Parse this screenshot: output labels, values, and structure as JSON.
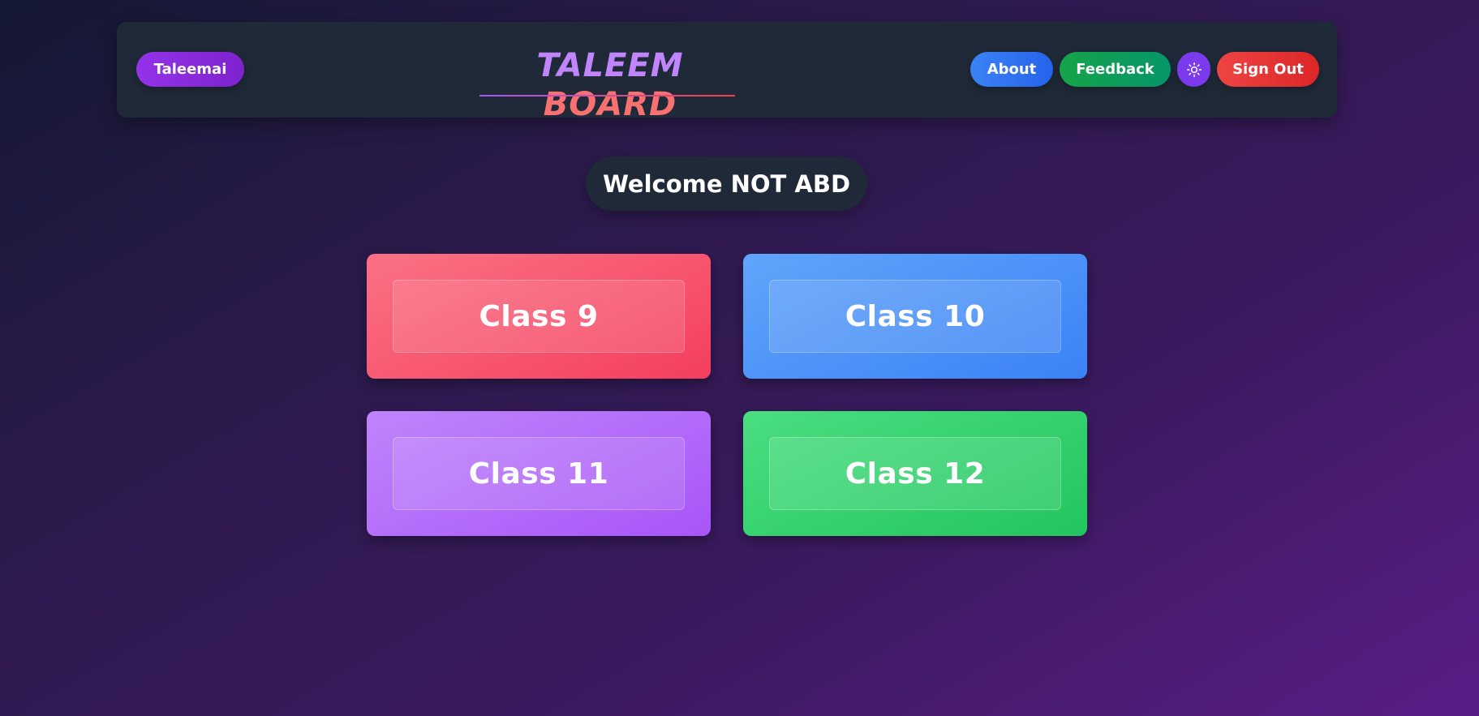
{
  "header": {
    "brand_button": "Taleemai",
    "logo_word1": "TALEEM",
    "logo_word2": "BOARD",
    "about_label": "About",
    "feedback_label": "Feedback",
    "theme_toggle_icon": "sun-icon",
    "signout_label": "Sign Out"
  },
  "welcome": {
    "text": "Welcome NOT ABD"
  },
  "classes": [
    {
      "label": "Class 9",
      "color": "#f43f5e"
    },
    {
      "label": "Class 10",
      "color": "#3b82f6"
    },
    {
      "label": "Class 11",
      "color": "#a855f7"
    },
    {
      "label": "Class 12",
      "color": "#22c55e"
    }
  ],
  "theme": {
    "header_bg": "#1f2937",
    "logo_accent_1": "#c084fc",
    "logo_accent_2": "#f87171"
  }
}
